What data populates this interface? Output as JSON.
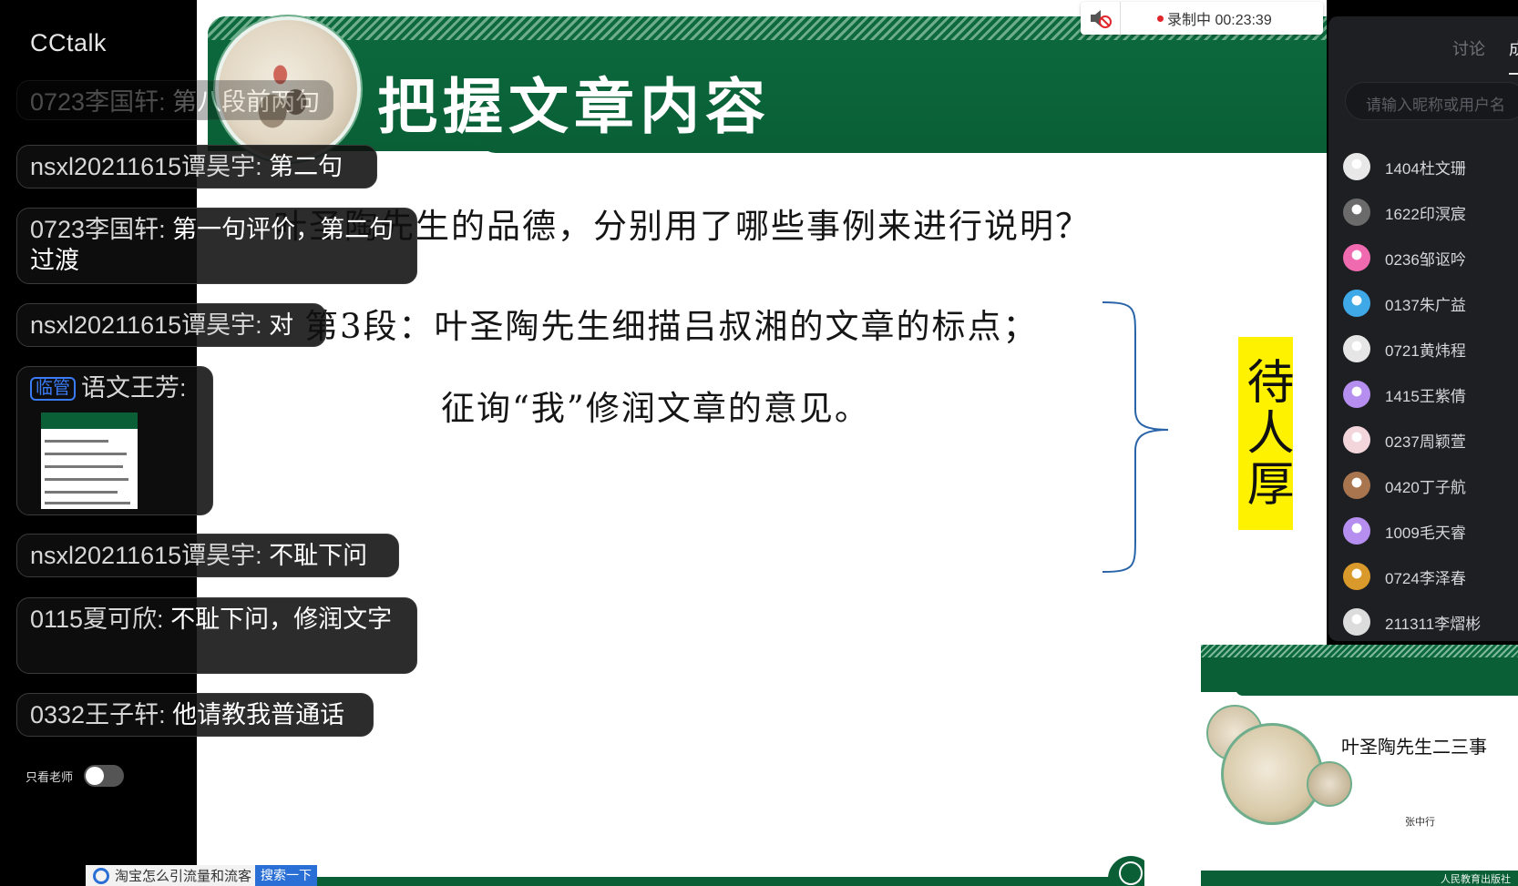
{
  "app": {
    "name": "CCtalk"
  },
  "recording": {
    "status_text": "录制中 00:23:39"
  },
  "slide": {
    "title": "把握文章内容",
    "question": "叶圣陶先生的品德，分别用了哪些事例来进行说明？",
    "line1": "第3段：叶圣陶先生细描吕叔湘的文章的标点；",
    "line2": "征询“我”修润文章的意见。",
    "highlight": "待人厚"
  },
  "chat": {
    "messages": [
      {
        "sender": "0723李国轩: ",
        "text": "第八段前两句"
      },
      {
        "sender": "nsxl20211615谭昊宇: ",
        "text": "第二句"
      },
      {
        "sender": "0723李国轩: ",
        "text": "第一句评价，第二句过渡"
      },
      {
        "sender": "nsxl20211615谭昊宇: ",
        "text": "对"
      },
      {
        "tag": "临管",
        "sender": "语文王芳:",
        "text": ""
      },
      {
        "sender": "nsxl20211615谭昊宇: ",
        "text": "不耻下问"
      },
      {
        "sender": "0115夏可欣: ",
        "text": "不耻下问，修润文字"
      },
      {
        "sender": "0332王子轩: ",
        "text": "他请教我普通话"
      }
    ],
    "teacher_only_label": "只看老师",
    "teacher_only_on": false
  },
  "members": {
    "tabs": {
      "discuss": "讨论",
      "members": "成"
    },
    "search_placeholder": "请输入昵称或用户名",
    "list": [
      {
        "name": "1404杜文珊",
        "avatar_color": "#e8e8e8"
      },
      {
        "name": "1622印溟宸",
        "avatar_color": "#6b6b6b"
      },
      {
        "name": "0236邹讴吟",
        "avatar_color": "#f06ab0"
      },
      {
        "name": "0137朱广益",
        "avatar_color": "#3fa9e8"
      },
      {
        "name": "0721黄炜程",
        "avatar_color": "#e6e6e6"
      },
      {
        "name": "1415王紫倩",
        "avatar_color": "#b58ef0"
      },
      {
        "name": "0237周颖萱",
        "avatar_color": "#f2d6dc"
      },
      {
        "name": "0420丁子航",
        "avatar_color": "#a8754f"
      },
      {
        "name": "1009毛天睿",
        "avatar_color": "#b58ef0"
      },
      {
        "name": "0724李泽春",
        "avatar_color": "#d99a2b"
      },
      {
        "name": "211311李熠彬",
        "avatar_color": "#dcdcdc"
      }
    ]
  },
  "preview": {
    "title": "叶圣陶先生二三事",
    "author": "张中行",
    "footer": "人民教育出版社"
  },
  "ad": {
    "text": "淘宝怎么引流量和流客",
    "button": "搜索一下"
  }
}
